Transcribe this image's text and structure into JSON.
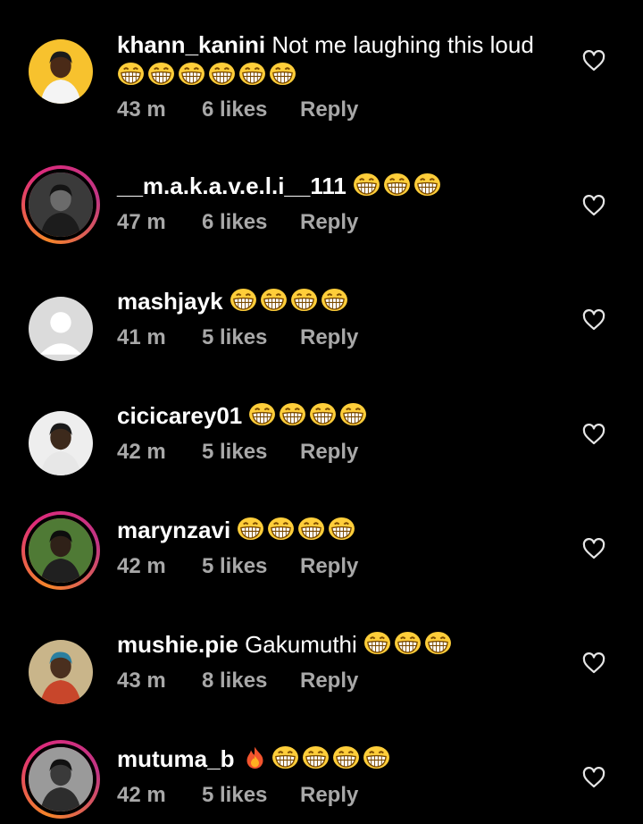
{
  "comments": [
    {
      "username": "khann_kanini",
      "text": "Not me laughing this loud",
      "emoji": [
        "😁",
        "😁",
        "😁",
        "😁",
        "😁",
        "😁"
      ],
      "time": "43 m",
      "likes": "6 likes",
      "reply": "Reply",
      "ring": false,
      "avatar": "yellow"
    },
    {
      "username": "__m.a.k.a.v.e.l.i__111",
      "text": "",
      "emoji": [
        "😁",
        "😁",
        "😁"
      ],
      "time": "47 m",
      "likes": "6 likes",
      "reply": "Reply",
      "ring": true,
      "avatar": "dark"
    },
    {
      "username": "mashjayk",
      "text": "",
      "emoji": [
        "😁",
        "😁",
        "😁",
        "😁"
      ],
      "time": "41 m",
      "likes": "5 likes",
      "reply": "Reply",
      "ring": false,
      "avatar": "default"
    },
    {
      "username": "cicicarey01",
      "text": "",
      "emoji": [
        "😁",
        "😁",
        "😁",
        "😁"
      ],
      "time": "42 m",
      "likes": "5 likes",
      "reply": "Reply",
      "ring": false,
      "avatar": "light"
    },
    {
      "username": "marynzavi",
      "text": "",
      "emoji": [
        "😁",
        "😁",
        "😁",
        "😁"
      ],
      "time": "42 m",
      "likes": "5 likes",
      "reply": "Reply",
      "ring": true,
      "avatar": "green"
    },
    {
      "username": "mushie.pie",
      "text": "Gakumuthi",
      "emoji": [
        "😁",
        "😁",
        "😁"
      ],
      "time": "43 m",
      "likes": "8 likes",
      "reply": "Reply",
      "ring": false,
      "avatar": "warm"
    },
    {
      "username": "mutuma_b",
      "text": "",
      "emoji": [
        "🔥",
        "😁",
        "😁",
        "😁",
        "😁"
      ],
      "time": "42 m",
      "likes": "5 likes",
      "reply": "Reply",
      "ring": true,
      "avatar": "gray"
    }
  ]
}
